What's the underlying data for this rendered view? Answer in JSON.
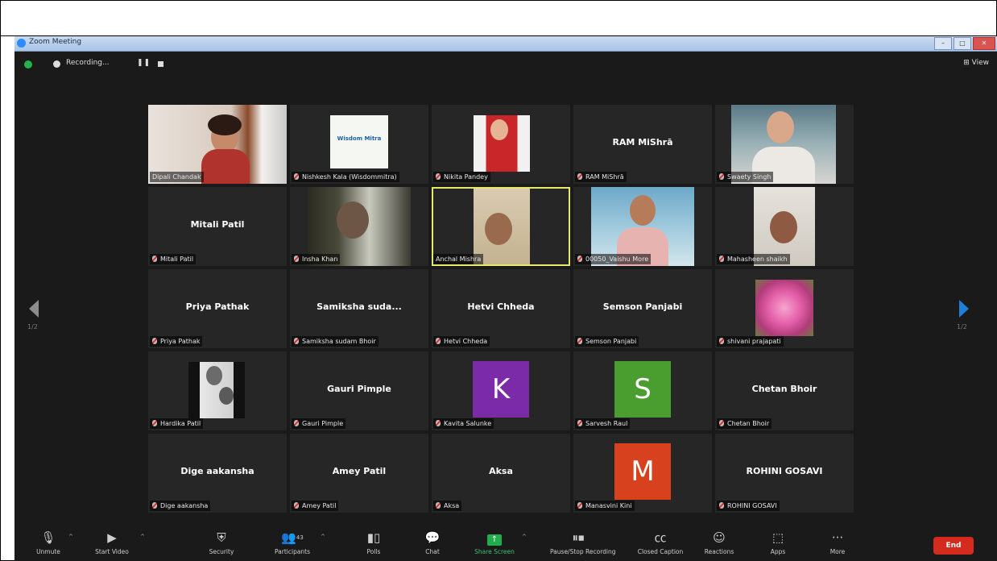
{
  "window": {
    "title": "Zoom Meeting",
    "controls": [
      "–",
      "□",
      "✕"
    ]
  },
  "topbar": {
    "recording_label": "Recording...",
    "pause_glyph": "❚❚",
    "view_label": "⊞ View"
  },
  "pagination": {
    "left": "1/2",
    "right": "1/2"
  },
  "tiles": [
    {
      "id": "dipali",
      "label": "Dipali Chandak",
      "type": "video"
    },
    {
      "id": "nishkesh",
      "label": "Nishkesh Kala (Wisdommitra)",
      "type": "logo",
      "logo_text": "Wisdom Mitra"
    },
    {
      "id": "nikita",
      "label": "Nikita Pandey",
      "type": "video"
    },
    {
      "id": "ram",
      "name": "RAM MiShrā",
      "label": "RAM MiShrā",
      "type": "name"
    },
    {
      "id": "swaety",
      "label": "Swaety Singh",
      "type": "video"
    },
    {
      "id": "mitali",
      "name": "Mitali Patil",
      "label": "Mitali Patil",
      "type": "name"
    },
    {
      "id": "insha",
      "label": "Insha Khan",
      "type": "video"
    },
    {
      "id": "anchal",
      "label": "Anchal Mishra",
      "type": "video",
      "active": true
    },
    {
      "id": "vaishu",
      "label": "00050_Vaishu More",
      "type": "video"
    },
    {
      "id": "mahasheen",
      "label": "Mahasheen shaikh",
      "type": "video"
    },
    {
      "id": "priya",
      "name": "Priya Pathak",
      "label": "Priya Pathak",
      "type": "name"
    },
    {
      "id": "samiksha",
      "name": "Samiksha suda...",
      "label": "Samiksha sudam Bhoir",
      "type": "name"
    },
    {
      "id": "hetvi",
      "name": "Hetvi Chheda",
      "label": "Hetvi Chheda",
      "type": "name"
    },
    {
      "id": "semson",
      "name": "Semson Panjabi",
      "label": "Semson Panjabi",
      "type": "name"
    },
    {
      "id": "shivani",
      "label": "shivani prajapati",
      "type": "photo"
    },
    {
      "id": "hardika",
      "label": "Hardika Patil",
      "type": "photo"
    },
    {
      "id": "gauri",
      "name": "Gauri Pimple",
      "label": "Gauri Pimple",
      "type": "name"
    },
    {
      "id": "kavita",
      "label": "Kavita Salunke",
      "type": "avatar",
      "letter": "K",
      "color": "#7b2aa8"
    },
    {
      "id": "sarvesh",
      "label": "Sarvesh Raul",
      "type": "avatar",
      "letter": "S",
      "color": "#4a9e2f"
    },
    {
      "id": "chetan",
      "name": "Chetan Bhoir",
      "label": "Chetan Bhoir",
      "type": "name"
    },
    {
      "id": "dige",
      "name": "Dige aakansha",
      "label": "Dige aakansha",
      "type": "name"
    },
    {
      "id": "amey",
      "name": "Amey Patil",
      "label": "Amey Patil",
      "type": "name"
    },
    {
      "id": "aksa",
      "name": "Aksa",
      "label": "Aksa",
      "type": "name"
    },
    {
      "id": "manasvini",
      "label": "Manasvini Kini",
      "type": "avatar",
      "letter": "M",
      "color": "#d8411e"
    },
    {
      "id": "rohini",
      "name": "ROHINI GOSAVI",
      "label": "ROHINI GOSAVI",
      "type": "name"
    }
  ],
  "toolbar": {
    "unmute": {
      "label": "Unmute",
      "icon": "mic-muted-icon"
    },
    "start_video": {
      "label": "Start Video",
      "icon": "video-off-icon"
    },
    "security": {
      "label": "Security",
      "icon": "shield-icon"
    },
    "participants": {
      "label": "Participants",
      "count": "43",
      "icon": "participants-icon"
    },
    "polls": {
      "label": "Polls",
      "icon": "polls-icon"
    },
    "chat": {
      "label": "Chat",
      "icon": "chat-icon"
    },
    "share_screen": {
      "label": "Share Screen",
      "icon": "share-screen-icon"
    },
    "recording": {
      "label": "Pause/Stop Recording",
      "icon": "pause-stop-icon"
    },
    "captions": {
      "label": "Closed Caption",
      "icon": "cc-icon"
    },
    "reactions": {
      "label": "Reactions",
      "icon": "reactions-icon"
    },
    "apps": {
      "label": "Apps",
      "icon": "apps-icon"
    },
    "more": {
      "label": "More",
      "icon": "more-icon"
    },
    "end": {
      "label": "End"
    }
  },
  "colors": {
    "background": "#1a1a1a",
    "tile": "#262626",
    "active_border": "#e5e86a",
    "end": "#d52b1e",
    "share": "#1fae4b",
    "nav_right": "#1d7fd8"
  }
}
